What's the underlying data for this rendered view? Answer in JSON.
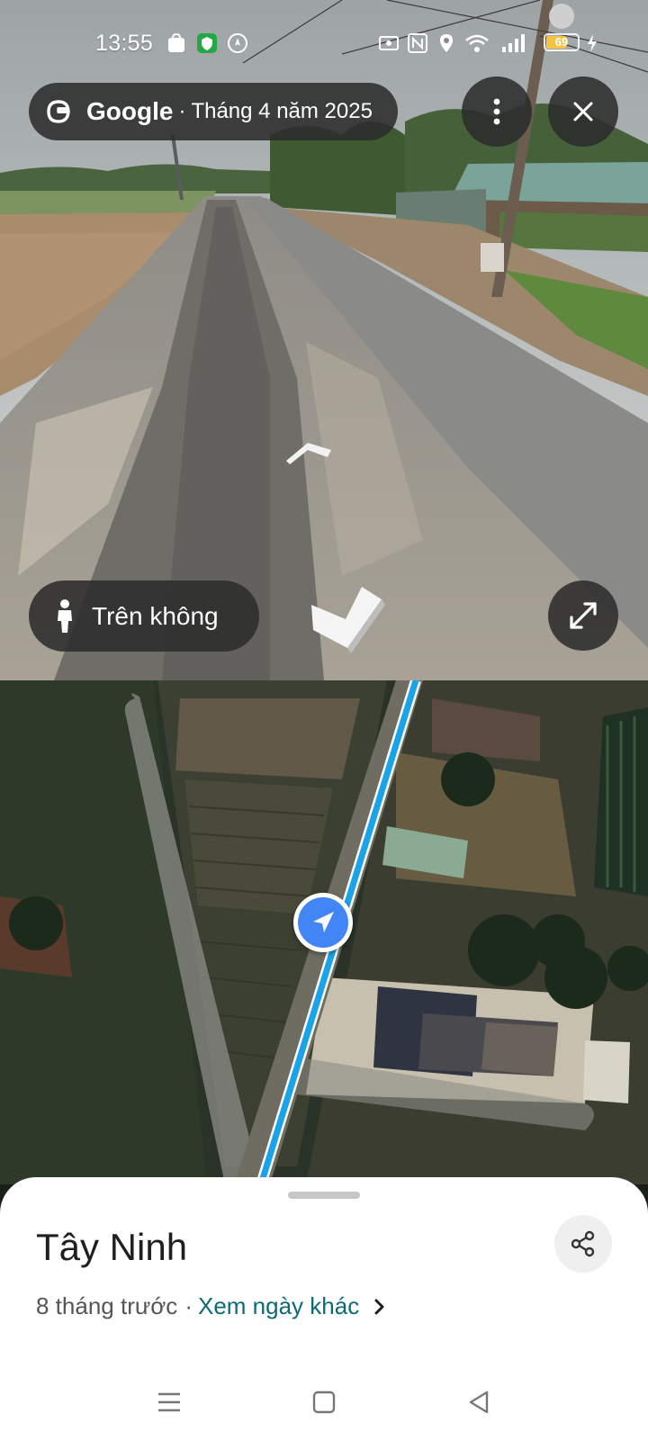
{
  "status_bar": {
    "time": "13:55",
    "battery_level": "69",
    "icons": [
      "shopee-icon",
      "shield-icon",
      "compass-icon",
      "nfc-icon",
      "n-icon",
      "location-pin-icon",
      "wifi-icon",
      "signal-icon",
      "battery-icon",
      "charging-icon"
    ]
  },
  "street_view": {
    "brand": "Google",
    "separator": "·",
    "capture_date": "Tháng 4 năm 2025",
    "aerial_label": "Trên không",
    "icons": {
      "logo": "google-g-logo",
      "more": "more-vertical-icon",
      "close": "close-icon",
      "navigate_forward": "chevron-up-arrow",
      "compass": "compass-chevron",
      "pegman": "pegman-icon",
      "expand": "expand-diagonal-icon"
    }
  },
  "map": {
    "route_color": "#1aa3e8",
    "location_color": "#4285f4",
    "location_icon": "navigation-arrow-icon"
  },
  "sheet": {
    "title": "Tây Ninh",
    "age": "8 tháng trước",
    "separator": "·",
    "other_dates_link": "Xem ngày khác",
    "share_icon": "share-icon",
    "chevron_icon": "chevron-right-icon"
  },
  "nav_bar": {
    "icons": [
      "menu-icon",
      "home-square-icon",
      "back-triangle-icon"
    ]
  }
}
